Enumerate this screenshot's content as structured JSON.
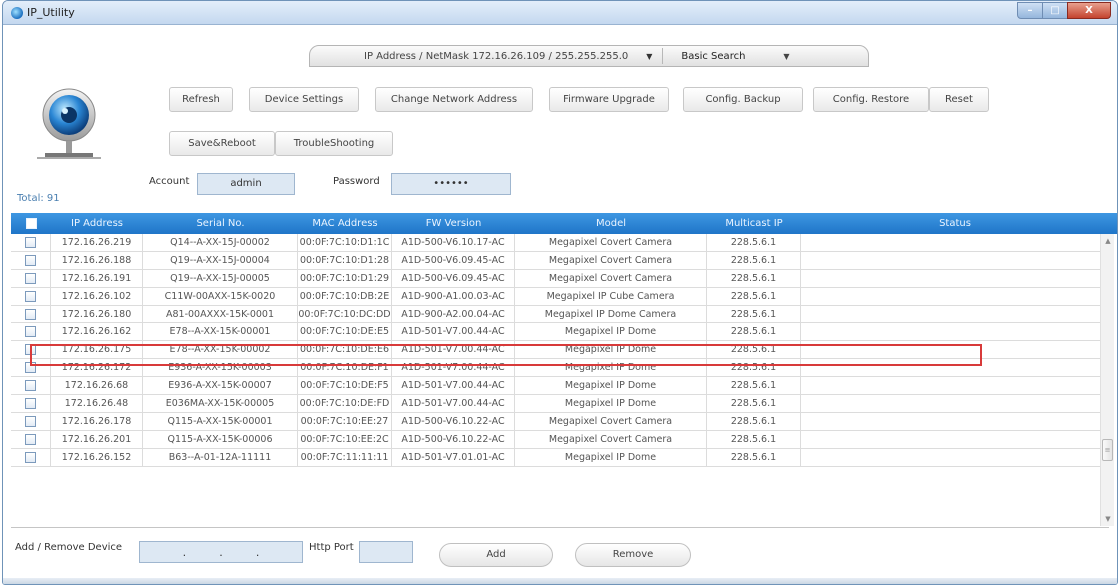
{
  "window": {
    "title": "IP_Utility",
    "minimize": "–",
    "maximize": "□",
    "close": "X"
  },
  "search": {
    "ip_netmask": "IP Address / NetMask  172.16.26.109 / 255.255.255.0",
    "mode": "Basic Search"
  },
  "toolbar": {
    "refresh": "Refresh",
    "device_settings": "Device Settings",
    "change_network_address": "Change Network Address",
    "firmware_upgrade": "Firmware Upgrade",
    "config_backup": "Config. Backup",
    "config_restore": "Config. Restore",
    "reset": "Reset",
    "save_reboot": "Save&Reboot",
    "troubleshooting": "TroubleShooting"
  },
  "login": {
    "account_label": "Account",
    "account_value": "admin",
    "password_label": "Password",
    "password_value": "••••••"
  },
  "total": "Total: 91",
  "table": {
    "headers": [
      "",
      "IP Address",
      "Serial No.",
      "MAC Address",
      "FW Version",
      "Model",
      "Multicast IP",
      "Status"
    ],
    "rows": [
      {
        "ip": "172.16.26.219",
        "serial": "Q14--A-XX-15J-00002",
        "mac": "00:0F:7C:10:D1:1C",
        "fw": "A1D-500-V6.10.17-AC",
        "model": "Megapixel Covert Camera",
        "mcast": "228.5.6.1",
        "status": ""
      },
      {
        "ip": "172.16.26.188",
        "serial": "Q19--A-XX-15J-00004",
        "mac": "00:0F:7C:10:D1:28",
        "fw": "A1D-500-V6.09.45-AC",
        "model": "Megapixel Covert Camera",
        "mcast": "228.5.6.1",
        "status": ""
      },
      {
        "ip": "172.16.26.191",
        "serial": "Q19--A-XX-15J-00005",
        "mac": "00:0F:7C:10:D1:29",
        "fw": "A1D-500-V6.09.45-AC",
        "model": "Megapixel Covert Camera",
        "mcast": "228.5.6.1",
        "status": ""
      },
      {
        "ip": "172.16.26.102",
        "serial": "C11W-00AXX-15K-0020",
        "mac": "00:0F:7C:10:DB:2E",
        "fw": "A1D-900-A1.00.03-AC",
        "model": "Megapixel IP Cube Camera",
        "mcast": "228.5.6.1",
        "status": ""
      },
      {
        "ip": "172.16.26.180",
        "serial": "A81-00AXXX-15K-0001",
        "mac": "00:0F:7C:10:DC:DD",
        "fw": "A1D-900-A2.00.04-AC",
        "model": "Megapixel IP Dome Camera",
        "mcast": "228.5.6.1",
        "status": ""
      },
      {
        "ip": "172.16.26.162",
        "serial": "E78--A-XX-15K-00001",
        "mac": "00:0F:7C:10:DE:E5",
        "fw": "A1D-501-V7.00.44-AC",
        "model": "Megapixel IP Dome",
        "mcast": "228.5.6.1",
        "status": ""
      },
      {
        "ip": "172.16.26.175",
        "serial": "E78--A-XX-15K-00002",
        "mac": "00:0F:7C:10:DE:E6",
        "fw": "A1D-501-V7.00.44-AC",
        "model": "Megapixel IP Dome",
        "mcast": "228.5.6.1",
        "status": ""
      },
      {
        "ip": "172.16.26.172",
        "serial": "E936-A-XX-15K-00003",
        "mac": "00:0F:7C:10:DE:F1",
        "fw": "A1D-501-V7.00.44-AC",
        "model": "Megapixel IP Dome",
        "mcast": "228.5.6.1",
        "status": ""
      },
      {
        "ip": "172.16.26.68",
        "serial": "E936-A-XX-15K-00007",
        "mac": "00:0F:7C:10:DE:F5",
        "fw": "A1D-501-V7.00.44-AC",
        "model": "Megapixel IP Dome",
        "mcast": "228.5.6.1",
        "status": ""
      },
      {
        "ip": "172.16.26.48",
        "serial": "E036MA-XX-15K-00005",
        "mac": "00:0F:7C:10:DE:FD",
        "fw": "A1D-501-V7.00.44-AC",
        "model": "Megapixel IP Dome",
        "mcast": "228.5.6.1",
        "status": ""
      },
      {
        "ip": "172.16.26.178",
        "serial": "Q115-A-XX-15K-00001",
        "mac": "00:0F:7C:10:EE:27",
        "fw": "A1D-500-V6.10.22-AC",
        "model": "Megapixel Covert Camera",
        "mcast": "228.5.6.1",
        "status": ""
      },
      {
        "ip": "172.16.26.201",
        "serial": "Q115-A-XX-15K-00006",
        "mac": "00:0F:7C:10:EE:2C",
        "fw": "A1D-500-V6.10.22-AC",
        "model": "Megapixel Covert Camera",
        "mcast": "228.5.6.1",
        "status": ""
      },
      {
        "ip": "172.16.26.152",
        "serial": "B63--A-01-12A-11111",
        "mac": "00:0F:7C:11:11:11",
        "fw": "A1D-501-V7.01.01-AC",
        "model": "Megapixel IP Dome",
        "mcast": "228.5.6.1",
        "status": ""
      }
    ]
  },
  "footer": {
    "add_remove_label": "Add / Remove Device",
    "ip_dot": ".",
    "http_port_label": "Http Port",
    "http_port_value": "",
    "add": "Add",
    "remove": "Remove"
  },
  "colors": {
    "accent": "#1f75c8",
    "highlight": "#d83a3a"
  }
}
